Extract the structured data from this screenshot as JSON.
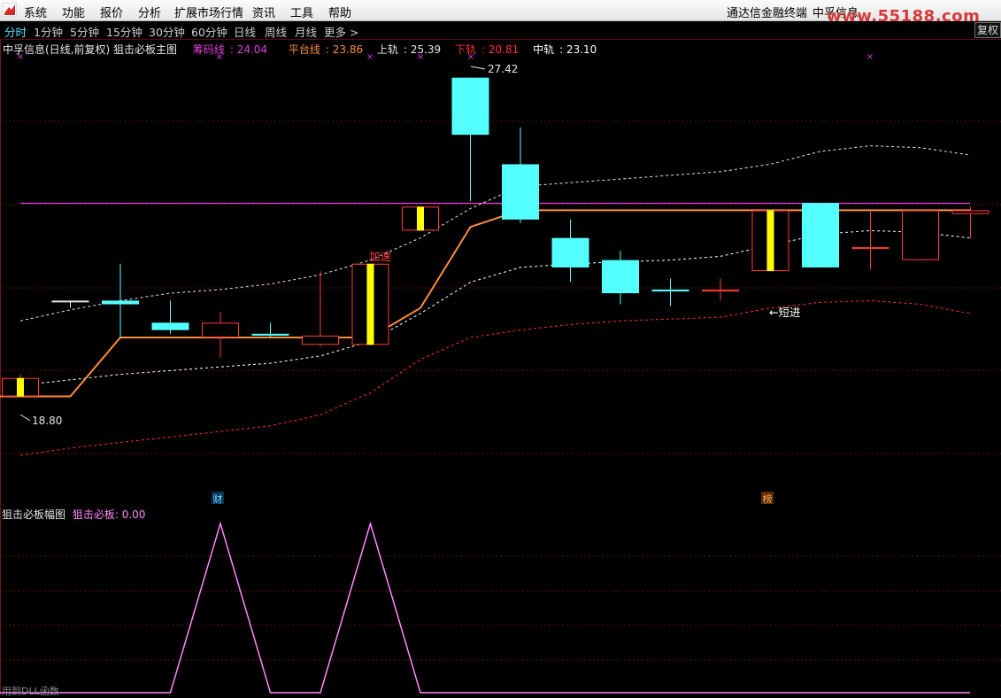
{
  "menubar": {
    "items": [
      "系统",
      "功能",
      "报价",
      "分析",
      "扩展市场行情",
      "资讯",
      "工具",
      "帮助"
    ],
    "right_items": [
      "通达信金融终端",
      "中孚信息"
    ],
    "watermark": "www.55188.com"
  },
  "periodbar": {
    "items": [
      "分时",
      "1分钟",
      "5分钟",
      "15分钟",
      "30分钟",
      "60分钟",
      "日线",
      "周线",
      "月线",
      "更多 >"
    ],
    "active": "分时",
    "fuquan_button": "复权"
  },
  "main_panel": {
    "title": "中孚信息(日线,前复权) 狙击必板主图",
    "indicators": [
      {
        "name": "筹码线",
        "value": "24.04",
        "color": "#e040e0"
      },
      {
        "name": "平台线",
        "value": "23.86",
        "color": "#ff8c3c"
      },
      {
        "name": "上轨",
        "value": "25.39",
        "color": "#e6e6e6"
      },
      {
        "name": "下轨",
        "value": "20.81",
        "color": "#ff3030"
      },
      {
        "name": "中轨",
        "value": "23.10",
        "color": "#ffffff"
      }
    ],
    "labels": {
      "high_price": "27.42",
      "low_price": "18.80",
      "signal_jiasu": "加速",
      "signal_duanjin": "←短进",
      "marker_cai": "财",
      "marker_bang": "榜"
    }
  },
  "sub_panel": {
    "title": "狙击必板幅图",
    "indicator_name": "狙击必板",
    "indicator_value": "0.00"
  },
  "status": {
    "text": "用到DLL函数"
  },
  "colors": {
    "up_candle": "#ff3c3c",
    "down_candle": "#54ffff",
    "marker_candle": "#ffff00",
    "chip_line": "#e040e0",
    "platform_line": "#ff8c3c",
    "upper_band": "#e6e6e6",
    "lower_band": "#ff3030",
    "sub_line": "#ff88ff"
  },
  "chart_data": {
    "type": "candlestick",
    "title": "中孚信息(日线,前复权) 狙击必板主图",
    "y_unit": "price",
    "ylim": [
      17.0,
      28.0
    ],
    "candles": [
      {
        "o": 18.8,
        "h": 19.4,
        "l": 18.8,
        "c": 19.3,
        "dir": "up",
        "flag": true
      },
      {
        "o": 21.4,
        "h": 21.4,
        "l": 21.2,
        "c": 21.4,
        "dir": "flat"
      },
      {
        "o": 21.4,
        "h": 22.4,
        "l": 20.4,
        "c": 21.3,
        "dir": "down"
      },
      {
        "o": 20.8,
        "h": 21.4,
        "l": 20.5,
        "c": 20.6,
        "dir": "down"
      },
      {
        "o": 20.4,
        "h": 21.1,
        "l": 19.85,
        "c": 20.8,
        "dir": "up"
      },
      {
        "o": 20.45,
        "h": 20.8,
        "l": 20.4,
        "c": 20.5,
        "dir": "down"
      },
      {
        "o": 20.2,
        "h": 22.2,
        "l": 20.15,
        "c": 20.45,
        "dir": "up"
      },
      {
        "o": 20.2,
        "h": 22.2,
        "l": 20.2,
        "c": 22.4,
        "dir": "up",
        "flag": true
      },
      {
        "o": 23.3,
        "h": 23.9,
        "l": 23.3,
        "c": 23.95,
        "dir": "up",
        "flag": true
      },
      {
        "o": 27.45,
        "h": 27.45,
        "l": 24.1,
        "c": 25.9,
        "dir": "down"
      },
      {
        "o": 25.1,
        "h": 26.1,
        "l": 23.5,
        "c": 23.6,
        "dir": "down"
      },
      {
        "o": 23.1,
        "h": 23.6,
        "l": 21.9,
        "c": 22.3,
        "dir": "down"
      },
      {
        "o": 22.5,
        "h": 22.75,
        "l": 21.3,
        "c": 21.6,
        "dir": "down"
      },
      {
        "o": 21.7,
        "h": 22.0,
        "l": 21.25,
        "c": 21.65,
        "dir": "down"
      },
      {
        "o": 21.65,
        "h": 22.0,
        "l": 21.4,
        "c": 21.7,
        "dir": "up"
      },
      {
        "o": 22.2,
        "h": 23.85,
        "l": 22.2,
        "c": 23.85,
        "dir": "up",
        "flag": true
      },
      {
        "o": 24.05,
        "h": 24.05,
        "l": 22.3,
        "c": 22.3,
        "dir": "down"
      },
      {
        "o": 22.8,
        "h": 23.85,
        "l": 22.25,
        "c": 22.85,
        "dir": "up"
      },
      {
        "o": 22.5,
        "h": 23.85,
        "l": 22.5,
        "c": 23.85,
        "dir": "up"
      },
      {
        "o": 23.75,
        "h": 23.95,
        "l": 23.1,
        "c": 23.85,
        "dir": "up"
      }
    ],
    "platform_line": [
      18.8,
      18.8,
      20.4,
      20.4,
      20.4,
      20.4,
      20.4,
      20.4,
      21.2,
      23.4,
      23.85,
      23.85,
      23.85,
      23.85,
      23.85,
      23.85,
      23.85,
      23.85,
      23.85,
      23.85
    ],
    "chip_line": 24.04,
    "upper_band": [
      20.85,
      21.15,
      21.4,
      21.6,
      21.7,
      21.85,
      22.1,
      22.5,
      23.1,
      23.9,
      24.5,
      24.6,
      24.7,
      24.8,
      24.9,
      25.1,
      25.45,
      25.6,
      25.55,
      25.35
    ],
    "middle_band": [
      19.1,
      19.25,
      19.4,
      19.5,
      19.6,
      19.7,
      19.9,
      20.3,
      21.05,
      21.9,
      22.3,
      22.4,
      22.45,
      22.5,
      22.6,
      22.9,
      23.2,
      23.3,
      23.25,
      23.1
    ],
    "lower_band": [
      17.2,
      17.4,
      17.55,
      17.7,
      17.85,
      18.0,
      18.3,
      18.9,
      19.8,
      20.4,
      20.6,
      20.75,
      20.85,
      20.9,
      20.95,
      21.2,
      21.35,
      21.4,
      21.3,
      21.05
    ],
    "sub_indicator": {
      "name": "狙击必板",
      "ylim": [
        0,
        1
      ],
      "x": [
        0,
        3.0,
        4.0,
        5.0,
        6.0,
        7.0,
        8.0,
        19.0
      ],
      "values": [
        0,
        0,
        1,
        0,
        0,
        1,
        0,
        0
      ]
    }
  }
}
